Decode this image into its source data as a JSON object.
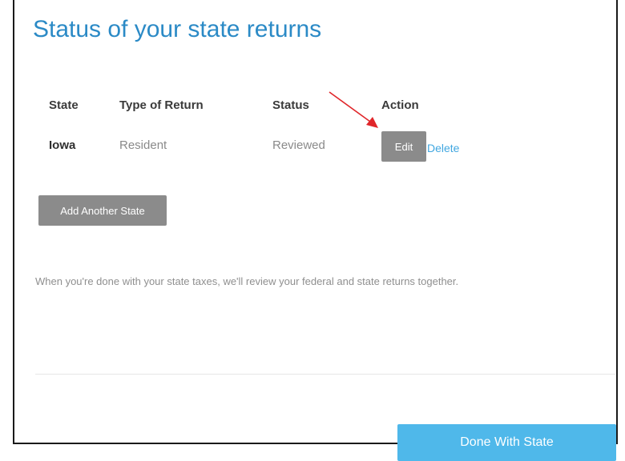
{
  "page": {
    "title": "Status of your state returns"
  },
  "table": {
    "headers": {
      "state": "State",
      "type": "Type of Return",
      "status": "Status",
      "action": "Action"
    },
    "rows": [
      {
        "state": "Iowa",
        "type": "Resident",
        "status": "Reviewed",
        "edit_label": "Edit",
        "delete_label": "Delete"
      }
    ]
  },
  "actions": {
    "add_state_label": "Add Another State",
    "done_label": "Done With State"
  },
  "info": {
    "text": "When you're done with your state taxes, we'll review your federal and state returns together."
  },
  "colors": {
    "title": "#2b8ac6",
    "button_gray": "#8b8b8b",
    "link_blue": "#41a7e0",
    "primary_blue": "#4fb8ea",
    "annotation_arrow": "#e0262a"
  },
  "annotation": {
    "icon": "red-arrow-icon",
    "points_to": "edit-button"
  }
}
